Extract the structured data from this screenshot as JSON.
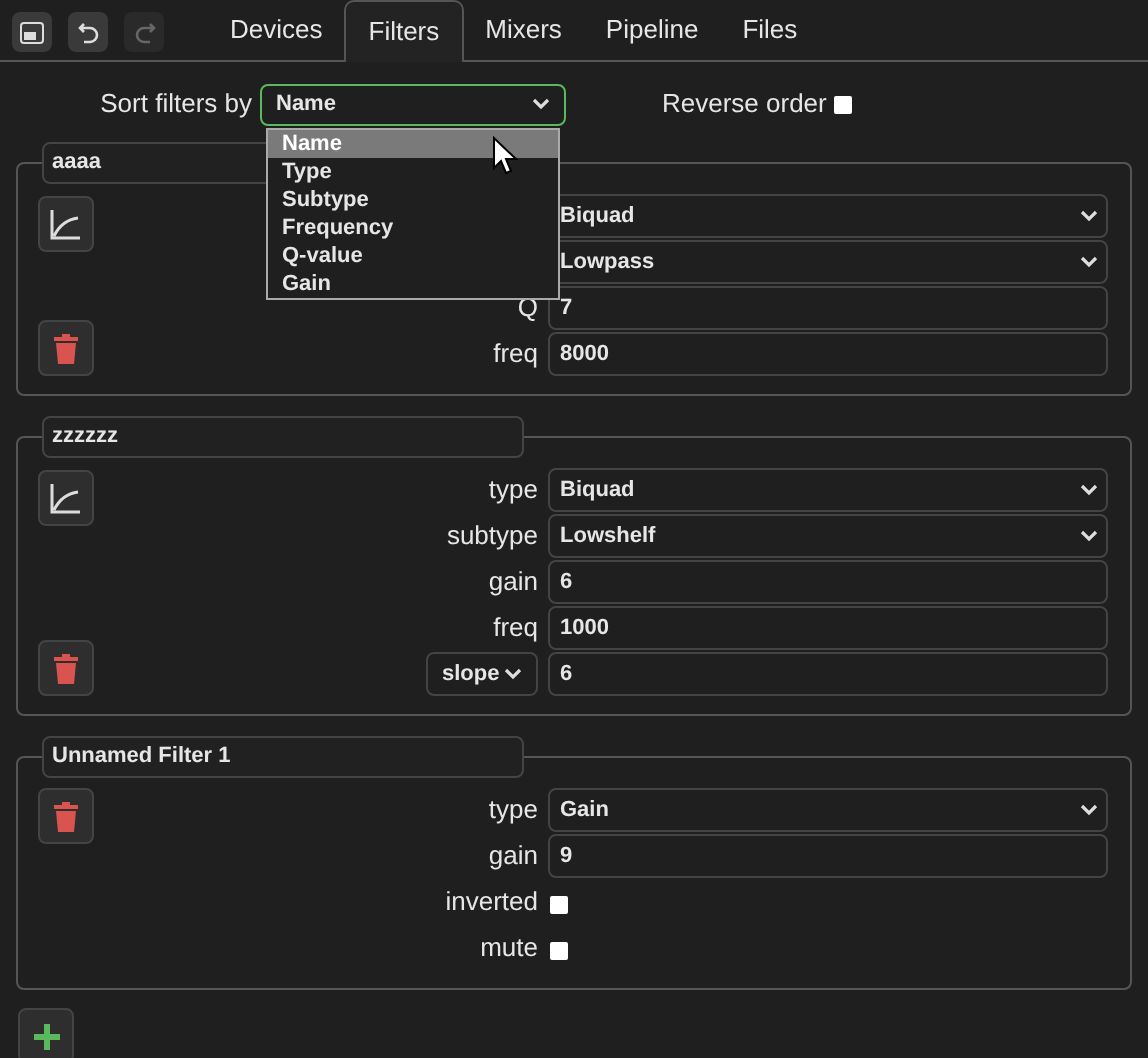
{
  "toolbar": [
    {
      "kind": "layout",
      "disabled": false
    },
    {
      "kind": "undo",
      "disabled": false
    },
    {
      "kind": "redo",
      "disabled": true
    }
  ],
  "tabs": [
    {
      "label": "Devices",
      "selected": false
    },
    {
      "label": "Filters",
      "selected": true
    },
    {
      "label": "Mixers",
      "selected": false
    },
    {
      "label": "Pipeline",
      "selected": false
    },
    {
      "label": "Files",
      "selected": false
    }
  ],
  "sort": {
    "label": "Sort filters by",
    "value": "Name",
    "expanded": true,
    "options": [
      {
        "label": "Name",
        "selected": true
      },
      {
        "label": "Type",
        "selected": false
      },
      {
        "label": "Subtype",
        "selected": false
      },
      {
        "label": "Frequency",
        "selected": false
      },
      {
        "label": "Q-value",
        "selected": false
      },
      {
        "label": "Gain",
        "selected": false
      }
    ],
    "reverse_label": "Reverse order",
    "reverse_checked": false
  },
  "filters": [
    {
      "name": "aaaa",
      "graph": true,
      "rows": [
        {
          "kind": "select",
          "value": "Biquad"
        },
        {
          "kind": "select",
          "value": "Lowpass"
        },
        {
          "kind": "input",
          "label": "Q",
          "value": "7"
        },
        {
          "kind": "input",
          "label": "freq",
          "value": "8000"
        }
      ]
    },
    {
      "name": "zzzzzz",
      "graph": true,
      "rows": [
        {
          "kind": "select",
          "label": "type",
          "value": "Biquad"
        },
        {
          "kind": "select",
          "label": "subtype",
          "value": "Lowshelf"
        },
        {
          "kind": "input",
          "label": "gain",
          "value": "6"
        },
        {
          "kind": "input",
          "label": "freq",
          "value": "1000"
        },
        {
          "kind": "input",
          "label_select": "slope",
          "value": "6"
        }
      ]
    },
    {
      "name": "Unnamed Filter 1",
      "graph": false,
      "rows": [
        {
          "kind": "select",
          "label": "type",
          "value": "Gain"
        },
        {
          "kind": "input",
          "label": "gain",
          "value": "9"
        },
        {
          "kind": "checkbox",
          "label": "inverted",
          "checked": false
        },
        {
          "kind": "checkbox",
          "label": "mute",
          "checked": false
        }
      ]
    }
  ]
}
